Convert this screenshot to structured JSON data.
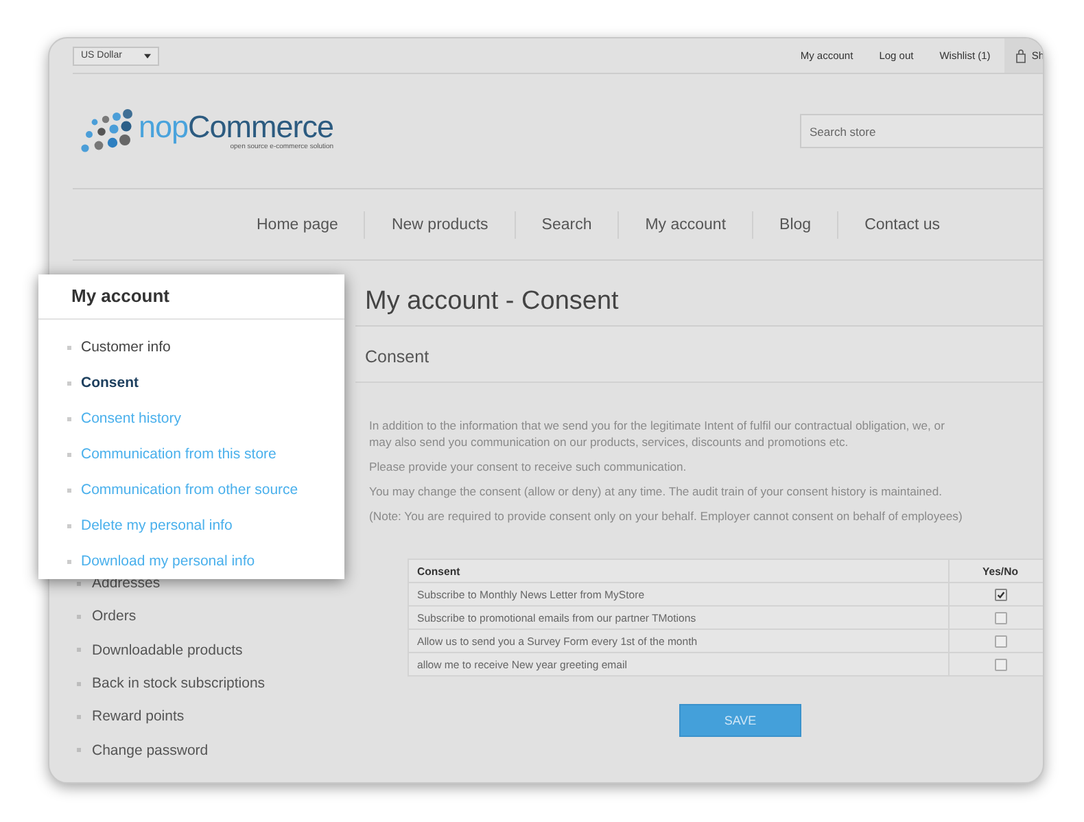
{
  "top_bar": {
    "currency": "US Dollar",
    "links": [
      "My account",
      "Log out",
      "Wishlist (1)"
    ],
    "cart": "Sh"
  },
  "logo": {
    "parts": [
      "nop",
      "Commerce"
    ],
    "tagline": "open source e-commerce solution"
  },
  "search": {
    "placeholder": "Search store"
  },
  "nav": [
    "Home page",
    "New products",
    "Search",
    "My account",
    "Blog",
    "Contact us"
  ],
  "sidebar": {
    "items": [
      "Addresses",
      "Orders",
      "Downloadable products",
      "Back in stock subscriptions",
      "Reward points",
      "Change password"
    ]
  },
  "page_title": "My account - Consent",
  "section_title": "Consent",
  "paragraphs": [
    [
      "In addition to the information that we send you for the legitimate Intent of fulfil our contractual obligation, we, or",
      "may also send you communication on our products, services, discounts and promotions etc."
    ],
    [
      "Please provide your consent to receive such communication."
    ],
    [
      "You may change the consent (allow or deny) at any time. The audit train of your consent history is maintained."
    ],
    [
      "(Note: You are required to provide consent only on your behalf. Employer cannot consent on behalf of employees)"
    ]
  ],
  "table": {
    "columns": [
      "Consent",
      "Yes/No"
    ],
    "rows": [
      {
        "label": "Subscribe to Monthly News Letter from MyStore",
        "checked": true
      },
      {
        "label": "Subscribe to promotional emails from our partner TMotions",
        "checked": false
      },
      {
        "label": "Allow us to send you a Survey Form every 1st of the month",
        "checked": false
      },
      {
        "label": "allow me to receive New year greeting email",
        "checked": false
      }
    ]
  },
  "save_button": "SAVE",
  "popup": {
    "title": "My account",
    "items": [
      {
        "label": "Customer info",
        "kind": "text",
        "selected": false
      },
      {
        "label": "Consent",
        "kind": "text",
        "selected": true
      },
      {
        "label": "Consent history",
        "kind": "link",
        "selected": false
      },
      {
        "label": "Communication from this store",
        "kind": "link",
        "selected": false
      },
      {
        "label": "Communication from other source",
        "kind": "link",
        "selected": false
      },
      {
        "label": "Delete my personal info",
        "kind": "link",
        "selected": false
      },
      {
        "label": "Download my personal info",
        "kind": "link",
        "selected": false
      }
    ]
  }
}
